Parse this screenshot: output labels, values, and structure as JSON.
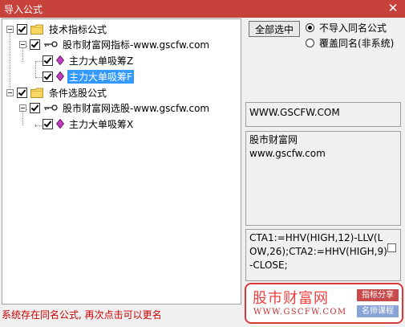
{
  "window": {
    "title": "导入公式",
    "close_glyph": "✕"
  },
  "tree": {
    "groups": [
      {
        "label": "技术指标公式",
        "children": [
          {
            "label": "股市财富网指标-www.gscfw.com",
            "items": [
              {
                "label": "主力大单吸筹Z",
                "selected": false
              },
              {
                "label": "主力大单吸筹F",
                "selected": true
              }
            ]
          }
        ]
      },
      {
        "label": "条件选股公式",
        "children": [
          {
            "label": "股市财富网选股-www.gscfw.com",
            "items": [
              {
                "label": "主力大单吸筹X",
                "selected": false
              }
            ]
          }
        ]
      }
    ]
  },
  "options": {
    "select_all_label": "全部选中",
    "radio_no_import": "不导入同名公式",
    "radio_overwrite": "覆盖同名(非系统)",
    "selected_radio": "no_import"
  },
  "info": {
    "site": "WWW.GSCFW.COM",
    "desc_line1": "股市财富网",
    "desc_line2": "www.gscfw.com",
    "formula": "CTA1:=HHV(HIGH,12)-LLV(LOW,26);CTA2:=HHV(HIGH,9)-CLOSE;"
  },
  "status_text": "系统存在同名公式, 再次点击可以更名",
  "logo": {
    "name": "股市财富网",
    "url": "WWW.GSCFW.COM",
    "tag1": "指标分享",
    "tag2": "名师课程",
    "accent": "#d83838"
  },
  "colors": {
    "titlebar": "#c8423c",
    "selection": "#3399ff",
    "status": "#cc0000"
  }
}
